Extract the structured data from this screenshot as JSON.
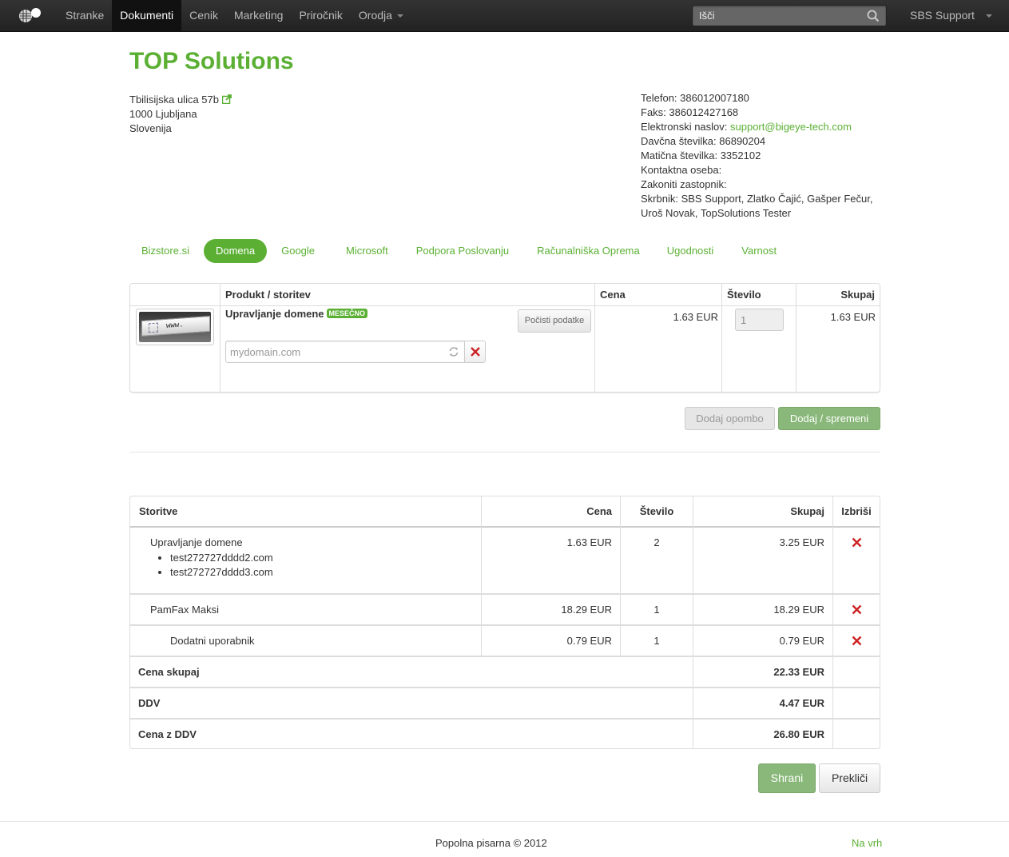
{
  "navbar": {
    "items": [
      {
        "label": "Stranke",
        "active": false
      },
      {
        "label": "Dokumenti",
        "active": true
      },
      {
        "label": "Cenik",
        "active": false
      },
      {
        "label": "Marketing",
        "active": false
      },
      {
        "label": "Priročnik",
        "active": false
      },
      {
        "label": "Orodja",
        "active": false,
        "dropdown": true
      }
    ],
    "search_placeholder": "Išči",
    "search_icon": "search-icon",
    "user_label": "SBS Support"
  },
  "company": {
    "name": "TOP Solutions",
    "address": [
      "Tbilisijska ulica 57b",
      "1000 Ljubljana",
      "Slovenija"
    ],
    "contact": {
      "phone": "Telefon: 386012007180",
      "fax": "Faks: 386012427168",
      "email_label": "Elektronski naslov:",
      "email": "support@bigeye-tech.com",
      "tax": "Davčna številka: 86890204",
      "reg": "Matična številka: 3352102",
      "person": "Kontaktna oseba:",
      "legal": "Zakoniti zastopnik:",
      "keeper1": "Skrbnik: SBS Support, Zlatko Čajić, Gašper Fečur,",
      "keeper2": "Uroš Novak, TopSolutions Tester"
    }
  },
  "tabs": [
    {
      "label": "Bizstore.si",
      "active": false
    },
    {
      "label": "Domena",
      "active": true
    },
    {
      "label": "Google",
      "active": false
    },
    {
      "label": "Microsoft",
      "active": false
    },
    {
      "label": "Podpora Poslovanju",
      "active": false
    },
    {
      "label": "Računalniška Oprema",
      "active": false
    },
    {
      "label": "Ugodnosti",
      "active": false
    },
    {
      "label": "Varnost",
      "active": false
    }
  ],
  "product_table": {
    "headers": {
      "product": "Produkt / storitev",
      "price": "Cena",
      "qty": "Število",
      "total": "Skupaj"
    },
    "row": {
      "thumb_text": "www.",
      "name": "Upravljanje domene",
      "badge": "MESEČNO",
      "clear_button": "Počisti podatke",
      "domain_placeholder": "mydomain.com",
      "price": "1.63 EUR",
      "qty": "1",
      "total": "1.63 EUR"
    },
    "add_note_button": "Dodaj opombo",
    "add_button": "Dodaj / spremeni"
  },
  "summary": {
    "headers": {
      "service": "Storitve",
      "price": "Cena",
      "qty": "Število",
      "total": "Skupaj",
      "delete": "Izbriši"
    },
    "rows": [
      {
        "name": "Upravljanje domene",
        "domains": [
          "test272727dddd2.com",
          "test272727dddd3.com"
        ],
        "price": "1.63 EUR",
        "qty": "2",
        "total": "3.25 EUR"
      },
      {
        "name": "PamFax Maksi",
        "price": "18.29 EUR",
        "qty": "1",
        "total": "18.29 EUR"
      },
      {
        "name": "Dodatni uporabnik",
        "price": "0.79 EUR",
        "qty": "1",
        "total": "0.79 EUR"
      }
    ],
    "totals": [
      {
        "label": "Cena skupaj",
        "value": "22.33 EUR"
      },
      {
        "label": "DDV",
        "value": "4.47 EUR"
      },
      {
        "label": "Cena z DDV",
        "value": "26.80 EUR"
      }
    ],
    "save_button": "Shrani",
    "cancel_button": "Prekliči"
  },
  "footer": {
    "copyright": "Popolna pisarna © 2012",
    "to_top": "Na vrh"
  },
  "colors": {
    "accent": "#5bb034",
    "navbar": "#222222",
    "delete": "#cc2222"
  }
}
